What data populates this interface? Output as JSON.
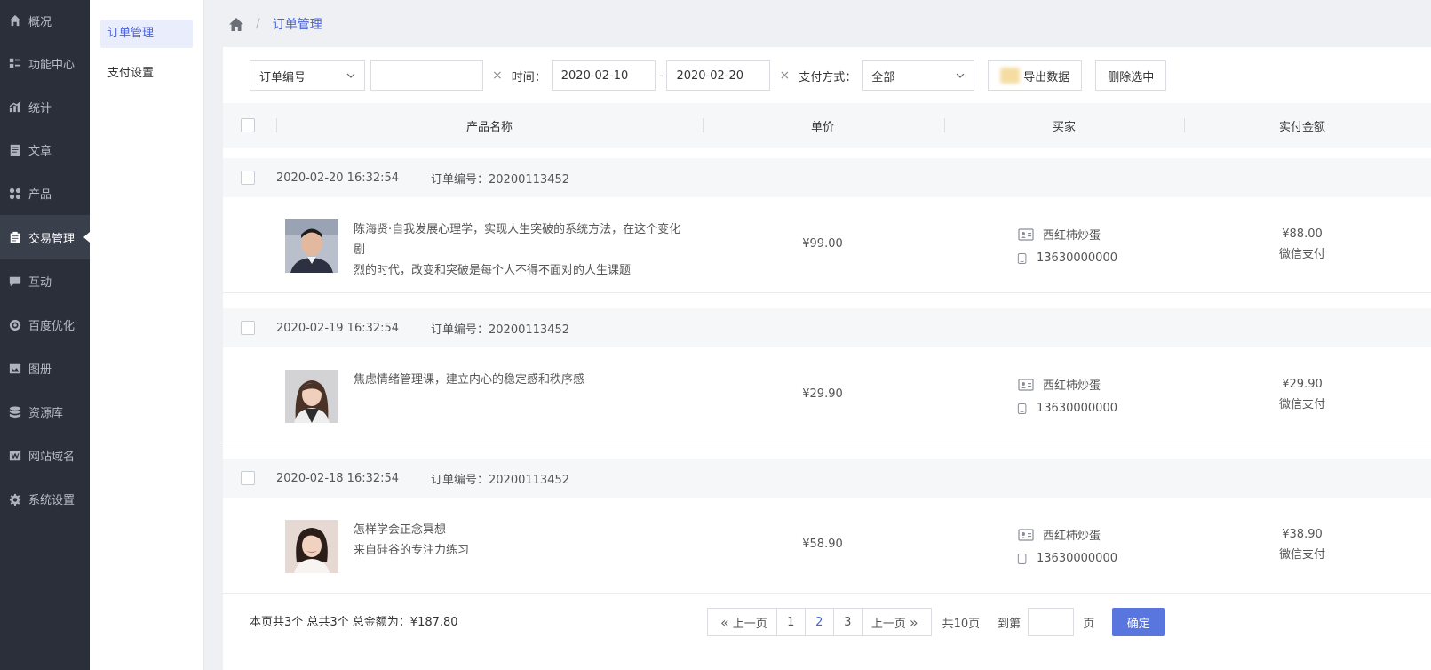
{
  "sidebar": {
    "items": [
      {
        "label": "概况",
        "icon": "home-icon"
      },
      {
        "label": "功能中心",
        "icon": "list-icon"
      },
      {
        "label": "统计",
        "icon": "chart-icon"
      },
      {
        "label": "文章",
        "icon": "document-icon"
      },
      {
        "label": "产品",
        "icon": "grid-icon"
      },
      {
        "label": "交易管理",
        "icon": "clipboard-icon",
        "active": true
      },
      {
        "label": "互动",
        "icon": "chat-icon"
      },
      {
        "label": "百度优化",
        "icon": "target-icon"
      },
      {
        "label": "图册",
        "icon": "image-icon"
      },
      {
        "label": "资源库",
        "icon": "database-icon"
      },
      {
        "label": "网站域名",
        "icon": "w-icon"
      },
      {
        "label": "系统设置",
        "icon": "gear-icon"
      }
    ]
  },
  "submenu": {
    "items": [
      {
        "label": "订单管理",
        "active": true
      },
      {
        "label": "支付设置"
      }
    ]
  },
  "breadcrumb": {
    "current": "订单管理"
  },
  "filter": {
    "type_select": "订单编号",
    "search_value": "",
    "clear": "×",
    "time_label": "时间：",
    "date_from": "2020-02-10",
    "dash": "-",
    "date_to": "2020-02-20",
    "pay_label": "支付方式：",
    "pay_select": "全部",
    "export_label": "导出数据",
    "delete_label": "删除选中"
  },
  "table": {
    "columns": [
      "产品名称",
      "单价",
      "买家",
      "实付金额"
    ]
  },
  "orders": [
    {
      "date": "2020-02-20 16:32:54",
      "order_no": "订单编号：20200113452",
      "product_line1": "陈海贤·自我发展心理学，实现人生突破的系统方法，在这个变化剧",
      "product_line2": "烈的时代，改变和突破是每个人不得不面对的人生课题",
      "price": "¥99.00",
      "buyer": "西红柿炒蛋",
      "phone": "13630000000",
      "paid": "¥88.00",
      "pay_method": "微信支付"
    },
    {
      "date": "2020-02-19 16:32:54",
      "order_no": "订单编号：20200113452",
      "product_line1": "焦虑情绪管理课，建立内心的稳定感和秩序感",
      "product_line2": "",
      "price": "¥29.90",
      "buyer": "西红柿炒蛋",
      "phone": "13630000000",
      "paid": "¥29.90",
      "pay_method": "微信支付"
    },
    {
      "date": "2020-02-18 16:32:54",
      "order_no": "订单编号：20200113452",
      "product_line1": "怎样学会正念冥想",
      "product_line2": "来自硅谷的专注力练习",
      "price": "¥58.90",
      "buyer": "西红柿炒蛋",
      "phone": "13630000000",
      "paid": "¥38.90",
      "pay_method": "微信支付"
    }
  ],
  "footer": {
    "summary": "本页共3个 总共3个 总金额为：¥187.80",
    "prev": "上一页",
    "pages": [
      "1",
      "2",
      "3"
    ],
    "current_page": "2",
    "next": "上一页",
    "total": "共10页",
    "goto": "到第",
    "page_input": "",
    "unit": "页",
    "confirm": "确定"
  },
  "colors": {
    "accent": "#4a64d8",
    "sidebar_bg": "#2b2f3a",
    "confirm_bg": "#5876dd"
  }
}
